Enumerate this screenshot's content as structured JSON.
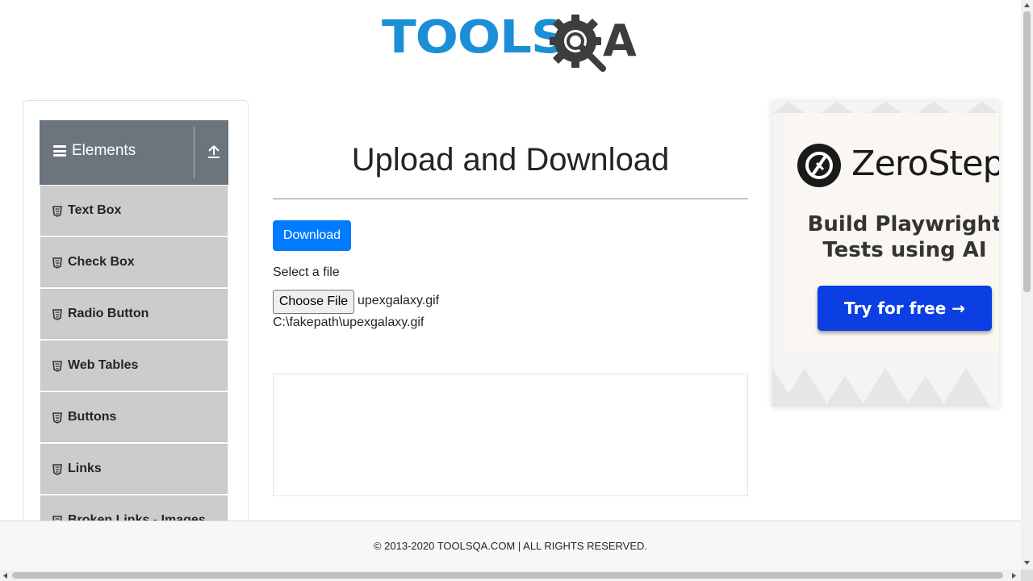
{
  "logo": {
    "text_tools": "TOOLS",
    "text_a": "A",
    "icon": "gear-magnifier-icon"
  },
  "sidebar": {
    "group_title": "Elements",
    "group_icon": "hamburger-icon",
    "collapse_icon": "upload-arrow-icon",
    "items": [
      {
        "label": "Text Box",
        "icon": "html5-icon"
      },
      {
        "label": "Check Box",
        "icon": "html5-icon"
      },
      {
        "label": "Radio Button",
        "icon": "html5-icon"
      },
      {
        "label": "Web Tables",
        "icon": "html5-icon"
      },
      {
        "label": "Buttons",
        "icon": "html5-icon"
      },
      {
        "label": "Links",
        "icon": "html5-icon"
      },
      {
        "label": "Broken Links - Images",
        "icon": "html5-icon"
      }
    ]
  },
  "main": {
    "title": "Upload and Download",
    "download_label": "Download",
    "select_label": "Select a file",
    "choose_file_label": "Choose File",
    "file_name": "upexgalaxy.gif",
    "uploaded_path": "C:\\fakepath\\upexgalaxy.gif"
  },
  "ad": {
    "brand": "ZeroStep",
    "headline_line1": "Build Playwright",
    "headline_line2": "Tests using AI",
    "cta": "Try for free →",
    "cta_color": "#0b3fe3"
  },
  "footer": {
    "text": "© 2013-2020 TOOLSQA.COM | ALL RIGHTS RESERVED."
  },
  "colors": {
    "brand_blue": "#1b8fd6",
    "primary_button": "#007bff",
    "sidebar_header": "#6c757d",
    "sidebar_item": "#cccccc"
  }
}
